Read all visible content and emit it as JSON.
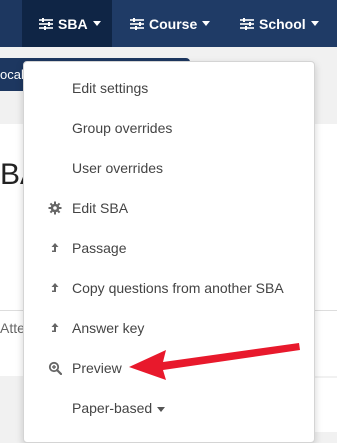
{
  "navbar": {
    "items": [
      {
        "label": "SBA",
        "icon": "sliders-icon",
        "active": true
      },
      {
        "label": "Course",
        "icon": "sliders-icon",
        "active": false
      },
      {
        "label": "School",
        "icon": "sliders-icon",
        "active": false
      }
    ]
  },
  "subbar": {
    "text": "ocab"
  },
  "background": {
    "title_fragment": "BA",
    "tab_fragment": "Atte"
  },
  "menu": {
    "items": [
      {
        "label": "Edit settings",
        "icon": ""
      },
      {
        "label": "Group overrides",
        "icon": ""
      },
      {
        "label": "User overrides",
        "icon": ""
      },
      {
        "label": "Edit SBA",
        "icon": "gear-icon"
      },
      {
        "label": "Passage",
        "icon": "upload-arrow-icon"
      },
      {
        "label": "Copy questions from another SBA",
        "icon": "upload-arrow-icon"
      },
      {
        "label": "Answer key",
        "icon": "upload-arrow-icon"
      },
      {
        "label": "Preview",
        "icon": "zoom-in-icon"
      },
      {
        "label": "Paper-based",
        "icon": "",
        "has_caret": true
      }
    ]
  },
  "colors": {
    "navbar": "#1f3b66",
    "navbar_active": "#0f2545",
    "annotation_arrow": "#e8192c"
  }
}
